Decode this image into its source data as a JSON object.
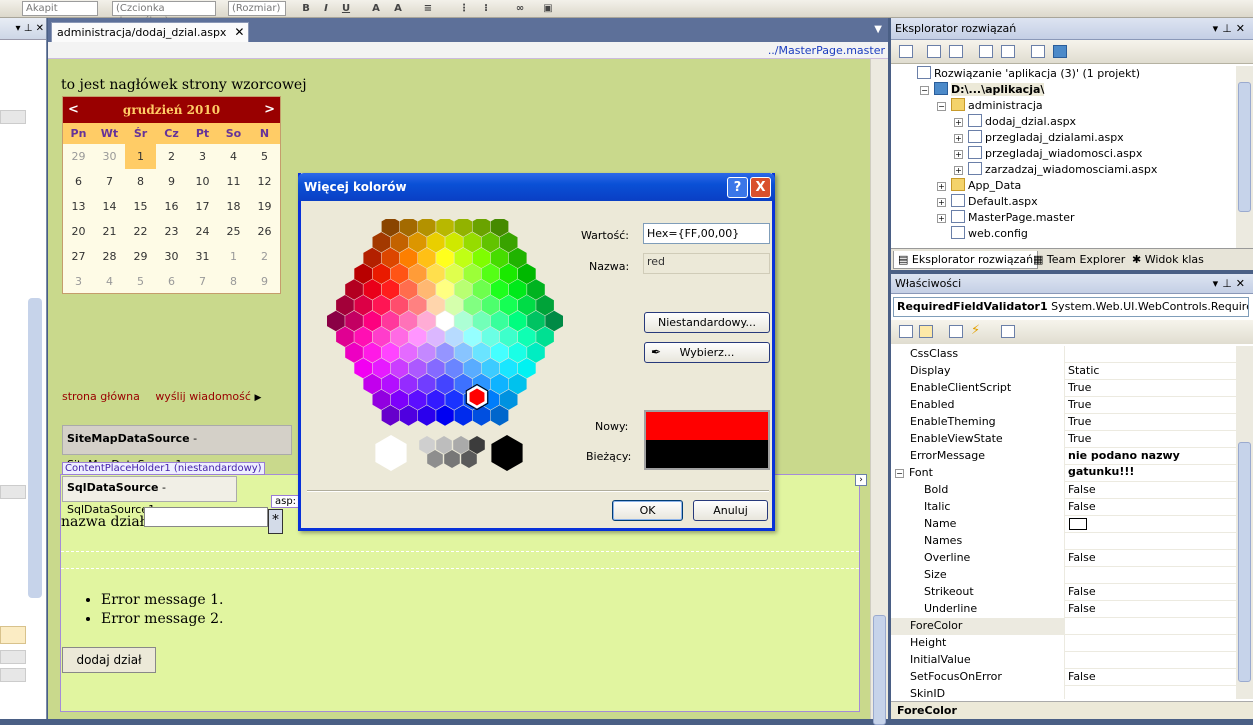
{
  "toolbar": {
    "combo1": "Akapit",
    "combo2": "(Czcionka domyślna)",
    "combo3": "(Rozmiar)",
    "bold": "B",
    "italic": "I",
    "underline": "U"
  },
  "editor": {
    "tab_label": "administracja/dodaj_dzial.aspx",
    "path": "../MasterPage.master",
    "header_text": "to jest nagłówek strony wzorcowej",
    "calendar": {
      "prev": "<",
      "next": ">",
      "month": "grudzień 2010",
      "days_of_week": [
        "Pn",
        "Wt",
        "Śr",
        "Cz",
        "Pt",
        "So",
        "N"
      ],
      "weeks": [
        [
          "29",
          "30",
          "1",
          "2",
          "3",
          "4",
          "5"
        ],
        [
          "6",
          "7",
          "8",
          "9",
          "10",
          "11",
          "12"
        ],
        [
          "13",
          "14",
          "15",
          "16",
          "17",
          "18",
          "19"
        ],
        [
          "20",
          "21",
          "22",
          "23",
          "24",
          "25",
          "26"
        ],
        [
          "27",
          "28",
          "29",
          "30",
          "31",
          "1",
          "2"
        ],
        [
          "3",
          "4",
          "5",
          "6",
          "7",
          "8",
          "9"
        ]
      ]
    },
    "nav_links": [
      "strona główna",
      "wyślij wiadomość"
    ],
    "sitemap_label_bold": "SiteMapDataSource",
    "sitemap_label": " - SiteMapDataSource1",
    "cph_label": "ContentPlaceHolder1 (niestandardowy)",
    "sqlds_label_bold": "SqlDataSource",
    "sqlds_label": " - SqlDataSource1",
    "asp_tag": "asp:",
    "field_label": "nazwa działu:",
    "validator_star": "*",
    "errors": [
      "Error message 1.",
      "Error message 2."
    ],
    "submit_button": "dodaj dział"
  },
  "dialog": {
    "title": "Więcej kolorów",
    "help": "?",
    "close": "X",
    "value_label": "Wartość:",
    "value": "Hex={FF,00,00}",
    "name_label": "Nazwa:",
    "name_value": "red",
    "custom_button": "Niestandardowy...",
    "pick_button": "Wybierz...",
    "new_label": "Nowy:",
    "current_label": "Bieżący:",
    "ok_button": "OK",
    "cancel_button": "Anuluj",
    "new_color": "#ff0000",
    "current_color": "#000000"
  },
  "solution": {
    "title": "Eksplorator rozwiązań",
    "items": [
      {
        "label": "Rozwiązanie 'aplikacja (3)' (1 projekt)",
        "indent": 0
      },
      {
        "label": "D:\\...\\aplikacja\\",
        "indent": 1,
        "bold": true
      },
      {
        "label": "administracja",
        "indent": 2
      },
      {
        "label": "dodaj_dzial.aspx",
        "indent": 3
      },
      {
        "label": "przegladaj_dzialami.aspx",
        "indent": 3
      },
      {
        "label": "przegladaj_wiadomosci.aspx",
        "indent": 3
      },
      {
        "label": "zarzadzaj_wiadomosciami.aspx",
        "indent": 3
      },
      {
        "label": "App_Data",
        "indent": 2
      },
      {
        "label": "Default.aspx",
        "indent": 2
      },
      {
        "label": "MasterPage.master",
        "indent": 2
      },
      {
        "label": "web.config",
        "indent": 2
      }
    ],
    "tabs": [
      "Eksplorator rozwiązań",
      "Team Explorer",
      "Widok klas"
    ]
  },
  "properties": {
    "title": "Właściwości",
    "object_bold": "RequiredFieldValidator1",
    "object_type": " System.Web.UI.WebControls.RequiredFi",
    "rows": [
      {
        "name": "CssClass",
        "value": "",
        "kind": "normal"
      },
      {
        "name": "Display",
        "value": "Static",
        "kind": "normal"
      },
      {
        "name": "EnableClientScript",
        "value": "True",
        "kind": "normal"
      },
      {
        "name": "Enabled",
        "value": "True",
        "kind": "normal"
      },
      {
        "name": "EnableTheming",
        "value": "True",
        "kind": "normal"
      },
      {
        "name": "EnableViewState",
        "value": "True",
        "kind": "normal"
      },
      {
        "name": "ErrorMessage",
        "value": "nie podano nazwy gatunku!!!",
        "kind": "bold"
      },
      {
        "name": "Font",
        "value": "",
        "kind": "cat"
      },
      {
        "name": "Bold",
        "value": "False",
        "kind": "sub"
      },
      {
        "name": "Italic",
        "value": "False",
        "kind": "sub"
      },
      {
        "name": "Name",
        "value": "",
        "kind": "sub"
      },
      {
        "name": "Names",
        "value": "",
        "kind": "sub"
      },
      {
        "name": "Overline",
        "value": "False",
        "kind": "sub"
      },
      {
        "name": "Size",
        "value": "",
        "kind": "sub"
      },
      {
        "name": "Strikeout",
        "value": "False",
        "kind": "sub"
      },
      {
        "name": "Underline",
        "value": "False",
        "kind": "sub"
      },
      {
        "name": "ForeColor",
        "value": "",
        "kind": "normal"
      },
      {
        "name": "Height",
        "value": "",
        "kind": "normal"
      },
      {
        "name": "InitialValue",
        "value": "",
        "kind": "normal"
      },
      {
        "name": "SetFocusOnError",
        "value": "False",
        "kind": "normal"
      },
      {
        "name": "SkinID",
        "value": "",
        "kind": "normal"
      }
    ],
    "footer": "ForeColor"
  }
}
